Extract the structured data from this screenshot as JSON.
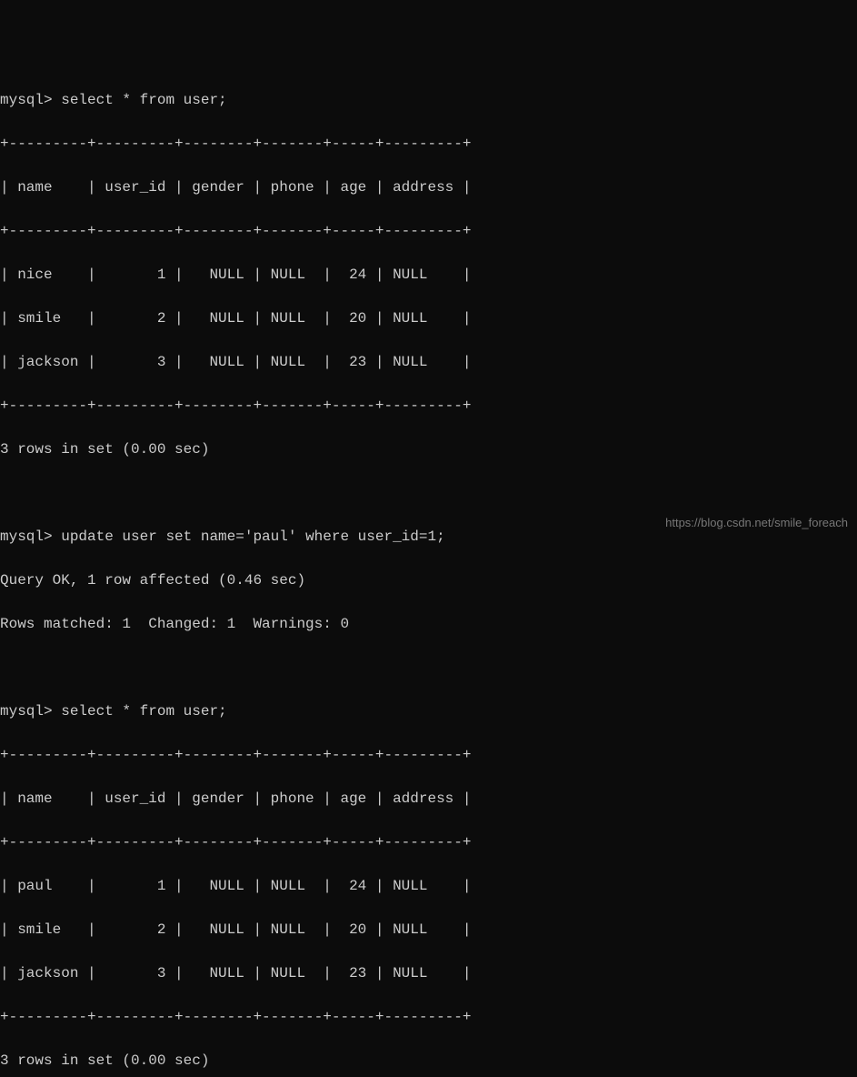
{
  "prompt": "mysql>",
  "queries": {
    "select1": "select * from user;",
    "update": "update user set name='paul' where user_id=1;",
    "select2": "select * from user;"
  },
  "update_result": {
    "line1": "Query OK, 1 row affected (0.46 sec)",
    "line2": "Rows matched: 1  Changed: 1  Warnings: 0"
  },
  "table1": {
    "border_top": "+---------+---------+--------+-------+-----+---------+",
    "header": "| name    | user_id | gender | phone | age | address |",
    "border_mid": "+---------+---------+--------+-------+-----+---------+",
    "rows": [
      "| nice    |       1 |   NULL | NULL  |  24 | NULL    |",
      "| smile   |       2 |   NULL | NULL  |  20 | NULL    |",
      "| jackson |       3 |   NULL | NULL  |  23 | NULL    |"
    ],
    "border_bot": "+---------+---------+--------+-------+-----+---------+",
    "footer": "3 rows in set (0.00 sec)"
  },
  "table2": {
    "border_top": "+---------+---------+--------+-------+-----+---------+",
    "header": "| name    | user_id | gender | phone | age | address |",
    "border_mid": "+---------+---------+--------+-------+-----+---------+",
    "rows": [
      "| paul    |       1 |   NULL | NULL  |  24 | NULL    |",
      "| smile   |       2 |   NULL | NULL  |  20 | NULL    |",
      "| jackson |       3 |   NULL | NULL  |  23 | NULL    |"
    ],
    "border_bot": "+---------+---------+--------+-------+-----+---------+",
    "footer": "3 rows in set (0.00 sec)"
  },
  "chart_data": {
    "type": "table",
    "columns": [
      "name",
      "user_id",
      "gender",
      "phone",
      "age",
      "address"
    ],
    "before_update": [
      {
        "name": "nice",
        "user_id": 1,
        "gender": null,
        "phone": null,
        "age": 24,
        "address": null
      },
      {
        "name": "smile",
        "user_id": 2,
        "gender": null,
        "phone": null,
        "age": 20,
        "address": null
      },
      {
        "name": "jackson",
        "user_id": 3,
        "gender": null,
        "phone": null,
        "age": 23,
        "address": null
      }
    ],
    "after_update": [
      {
        "name": "paul",
        "user_id": 1,
        "gender": null,
        "phone": null,
        "age": 24,
        "address": null
      },
      {
        "name": "smile",
        "user_id": 2,
        "gender": null,
        "phone": null,
        "age": 20,
        "address": null
      },
      {
        "name": "jackson",
        "user_id": 3,
        "gender": null,
        "phone": null,
        "age": 23,
        "address": null
      }
    ]
  },
  "watermark": "https://blog.csdn.net/smile_foreach"
}
